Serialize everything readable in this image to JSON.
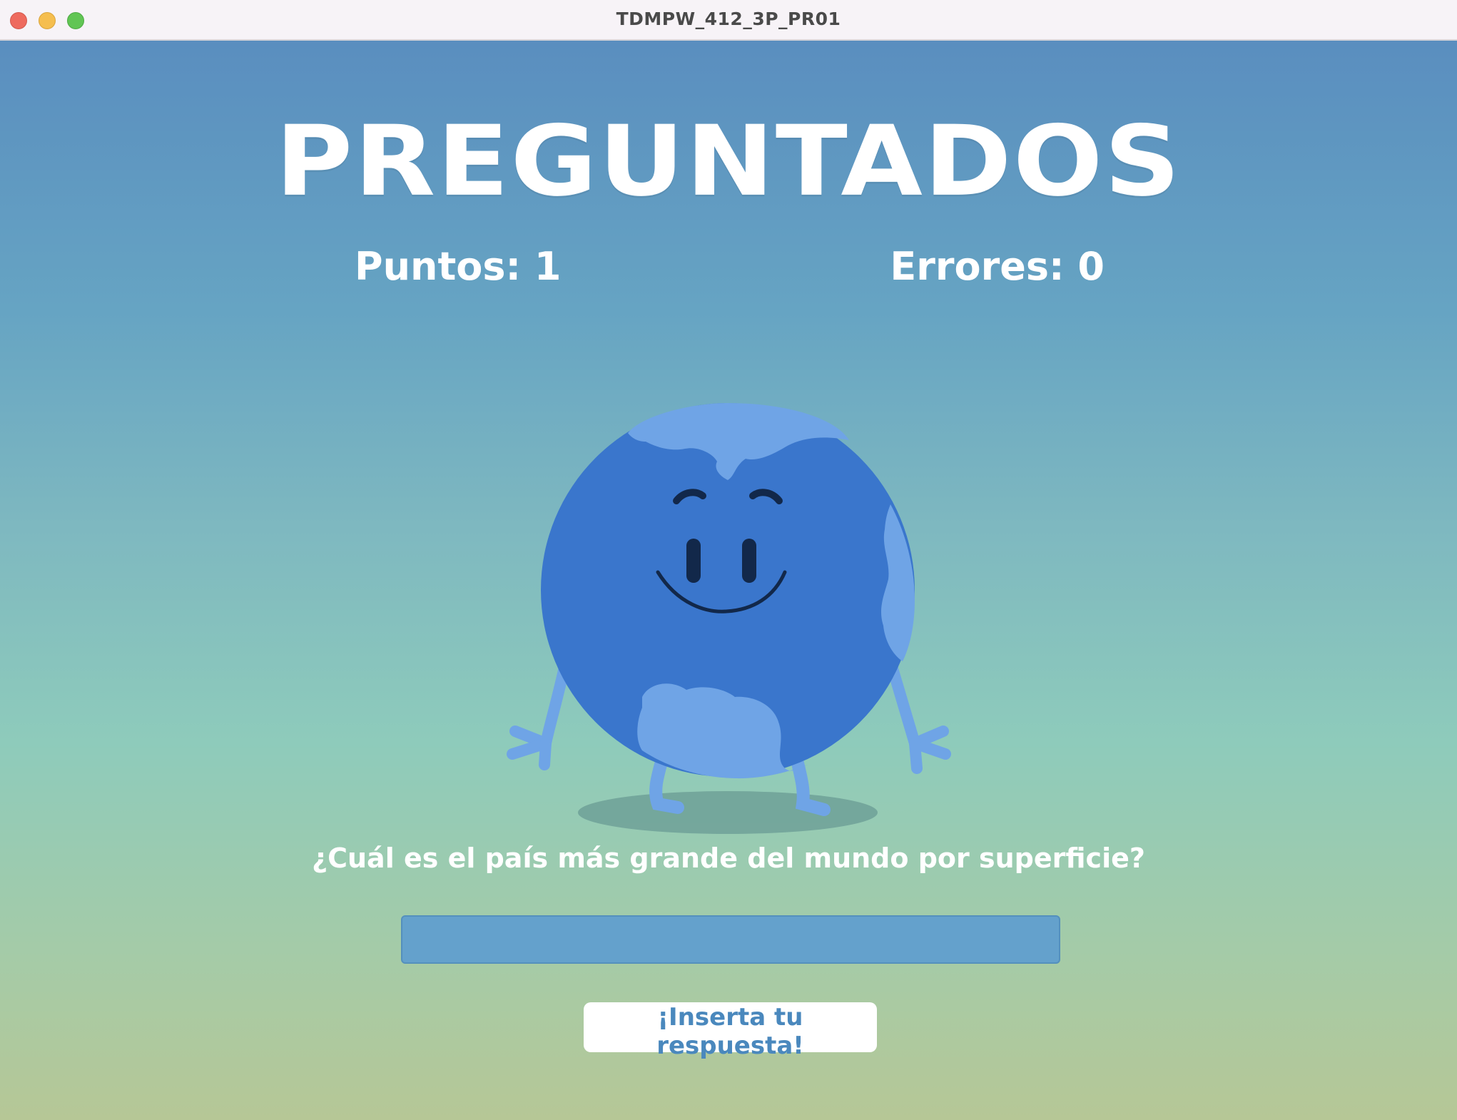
{
  "window": {
    "title": "TDMPW_412_3P_PR01"
  },
  "game": {
    "title": "PREGUNTADOS",
    "points": "Puntos: 1",
    "errors": "Errores: 0",
    "question": "¿Cuál es el país más grande del mundo por superficie?",
    "answer_value": "",
    "submit_label": "¡Inserta tu respuesta!"
  },
  "icons": {
    "mascot": "earth-character-icon"
  },
  "colors": {
    "background_top": "#5a8ebf",
    "background_bottom": "#b6c796",
    "globe_ocean": "#3a76cc",
    "globe_land": "#6fa4e6",
    "input_fill": "#64a1cc",
    "button_text": "#4a88bd"
  }
}
